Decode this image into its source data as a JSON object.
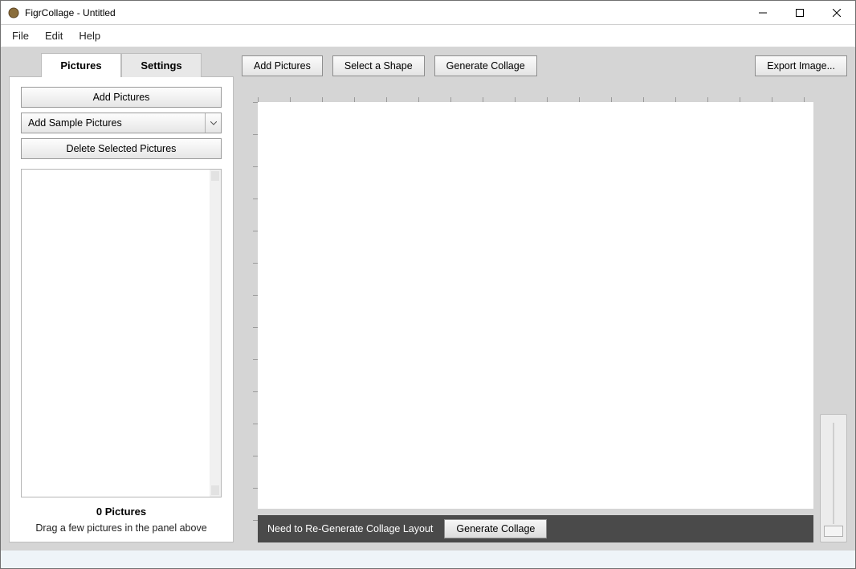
{
  "window": {
    "title": "FigrCollage - Untitled"
  },
  "menubar": {
    "file": "File",
    "edit": "Edit",
    "help": "Help"
  },
  "tabs": {
    "pictures": "Pictures",
    "settings": "Settings"
  },
  "sidebar": {
    "add_pictures": "Add Pictures",
    "add_sample": "Add Sample Pictures",
    "delete_selected": "Delete Selected Pictures",
    "count_label": "0 Pictures",
    "hint": "Drag a few pictures in the panel above"
  },
  "toolbar": {
    "add_pictures": "Add Pictures",
    "select_shape": "Select a Shape",
    "generate_collage": "Generate Collage",
    "export_image": "Export Image..."
  },
  "status": {
    "message": "Need to Re-Generate Collage Layout",
    "generate": "Generate Collage"
  }
}
